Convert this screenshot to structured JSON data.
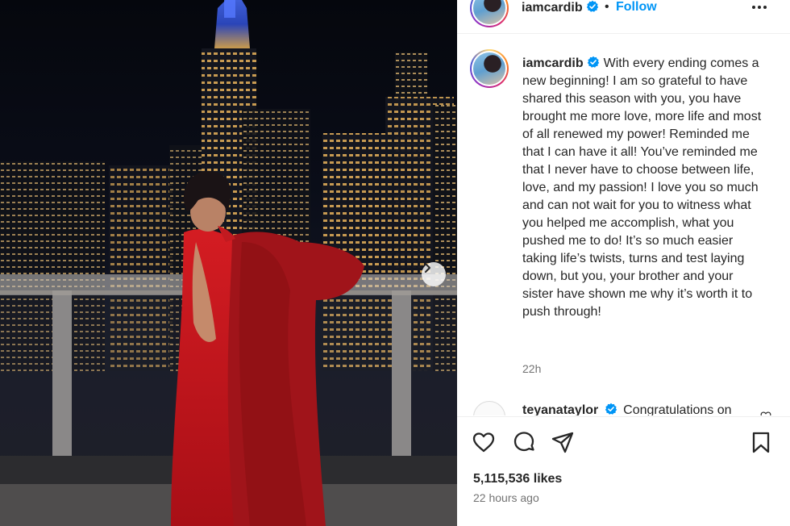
{
  "post": {
    "username": "iamcardib",
    "follow_label": "Follow",
    "header_separator": "•",
    "caption": "With every ending comes a new beginning! I am so grateful to have shared this season with you, you have brought me more love, more life and most of all renewed my power! Reminded me that I can have it all! You’ve reminded me that I never have to choose between life, love, and my passion! I love you so much and can not wait for you to witness what you helped me accomplish, what you pushed me to do! It’s so much easier taking life’s twists, turns and test laying down, but you, your brother and your sister have shown me why it’s worth it to push through!",
    "caption_age": "22h",
    "likes": "5,115,536 likes",
    "posted_ago": "22 hours ago"
  },
  "comment": {
    "username": "teyanataylor",
    "text": "Congratulations on"
  },
  "icons": {
    "verified": "verified-badge-icon",
    "more": "more-options-icon",
    "next": "chevron-right-icon",
    "like": "heart-icon",
    "comment": "comment-bubble-icon",
    "share": "paper-plane-icon",
    "save": "bookmark-icon"
  },
  "colors": {
    "follow": "#0095f6",
    "verified": "#0095f6",
    "text": "#262626",
    "muted": "#737373",
    "dress": "#c8161d"
  }
}
